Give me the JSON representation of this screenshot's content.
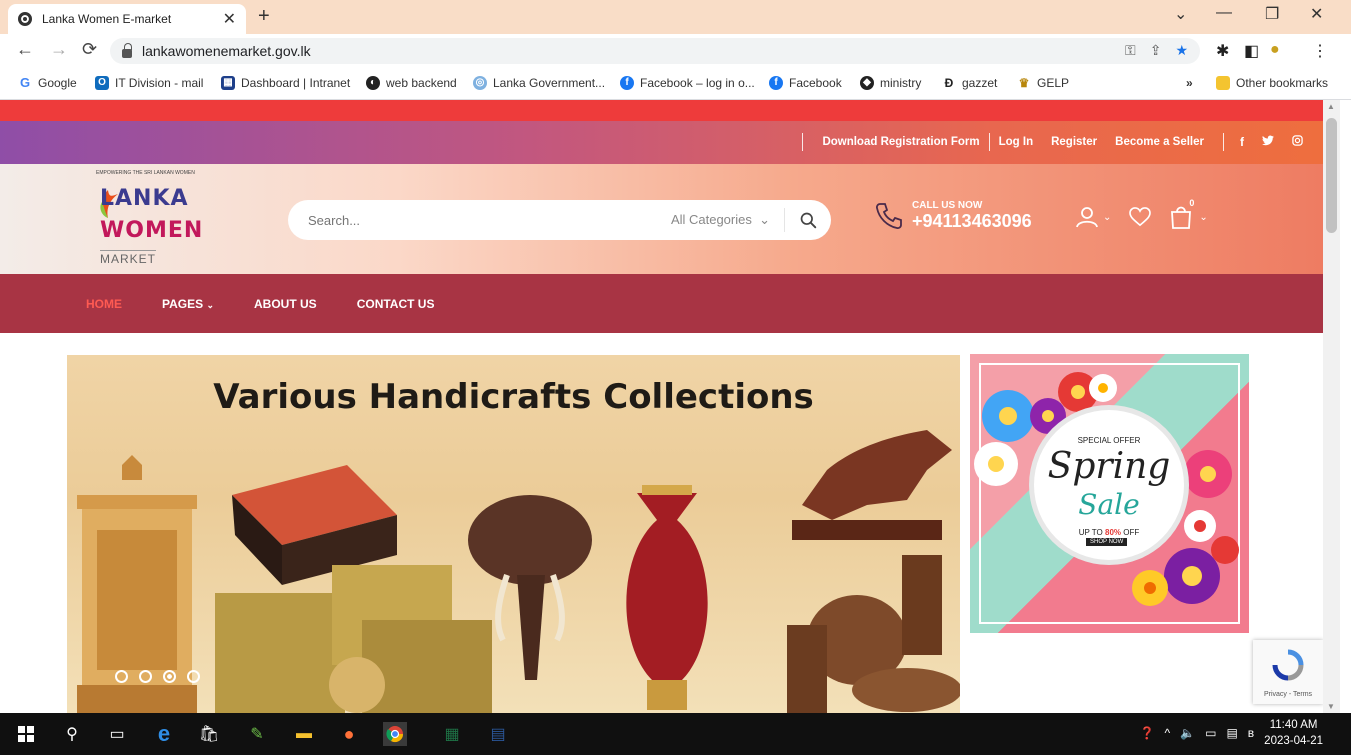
{
  "browser": {
    "tab_title": "Lanka Women E-market",
    "url": "lankawomenemarket.gov.lk",
    "bookmarks": [
      {
        "label": "Google",
        "icon": "google-icon"
      },
      {
        "label": "IT Division - mail",
        "icon": "outlook-icon"
      },
      {
        "label": "Dashboard | Intranet",
        "icon": "dashboard-icon"
      },
      {
        "label": "web backend",
        "icon": "backend-icon"
      },
      {
        "label": "Lanka Government...",
        "icon": "government-icon"
      },
      {
        "label": "Facebook – log in o...",
        "icon": "facebook-icon"
      },
      {
        "label": "Facebook",
        "icon": "facebook-icon"
      },
      {
        "label": "ministry",
        "icon": "ministry-icon"
      },
      {
        "label": "gazzet",
        "icon": "gazzet-icon"
      },
      {
        "label": "GELP",
        "icon": "gelp-icon"
      }
    ],
    "more_bookmarks": "»",
    "other_bookmarks": "Other bookmarks"
  },
  "topbar": {
    "links": [
      "Download Registration Form",
      "Log In",
      "Register",
      "Become a Seller"
    ],
    "social": [
      "f",
      "t",
      "ig"
    ]
  },
  "header": {
    "logo": {
      "tagline": "EMPOWERING THE SRI LANKAN WOMEN",
      "line1": "LANKA",
      "line2": "WOMEN",
      "line3": "MARKET"
    },
    "search_placeholder": "Search...",
    "category": "All Categories",
    "call_label": "CALL US NOW",
    "call_number": "+94113463096",
    "cart_count": "0"
  },
  "nav": {
    "items": [
      "HOME",
      "PAGES",
      "ABOUT US",
      "CONTACT US"
    ]
  },
  "slider": {
    "headline": "Various Handicrafts Collections",
    "active_slide": 2,
    "slide_count": 4
  },
  "promo": {
    "special": "SPECIAL OFFER",
    "spring": "Spring",
    "sale": "Sale",
    "up_to": "UP TO",
    "discount": "80%",
    "off": "OFF",
    "shop_now": "SHOP NOW"
  },
  "recaptcha": {
    "label": "Privacy - Terms"
  },
  "taskbar": {
    "time": "11:40 AM",
    "date": "2023-04-21"
  },
  "colors": {
    "tabstrip": "#f9ddc7",
    "nav_bg": "#a83444",
    "nav_active": "#ff5a52",
    "red_strip": "#ee3b3b"
  }
}
